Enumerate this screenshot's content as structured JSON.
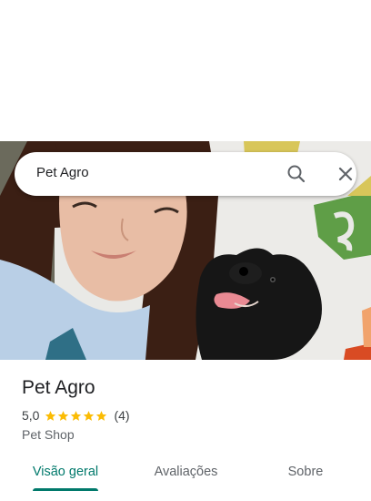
{
  "search": {
    "query": "Pet Agro",
    "search_icon": "search-icon",
    "close_icon": "close-icon"
  },
  "place": {
    "name": "Pet Agro",
    "rating": "5,0",
    "stars": 5,
    "review_count": "(4)",
    "category": "Pet Shop"
  },
  "tabs": [
    {
      "label": "Visão geral",
      "active": true
    },
    {
      "label": "Avaliações",
      "active": false
    },
    {
      "label": "Sobre",
      "active": false
    }
  ],
  "colors": {
    "accent": "#00796b",
    "star": "#fbbc04"
  }
}
